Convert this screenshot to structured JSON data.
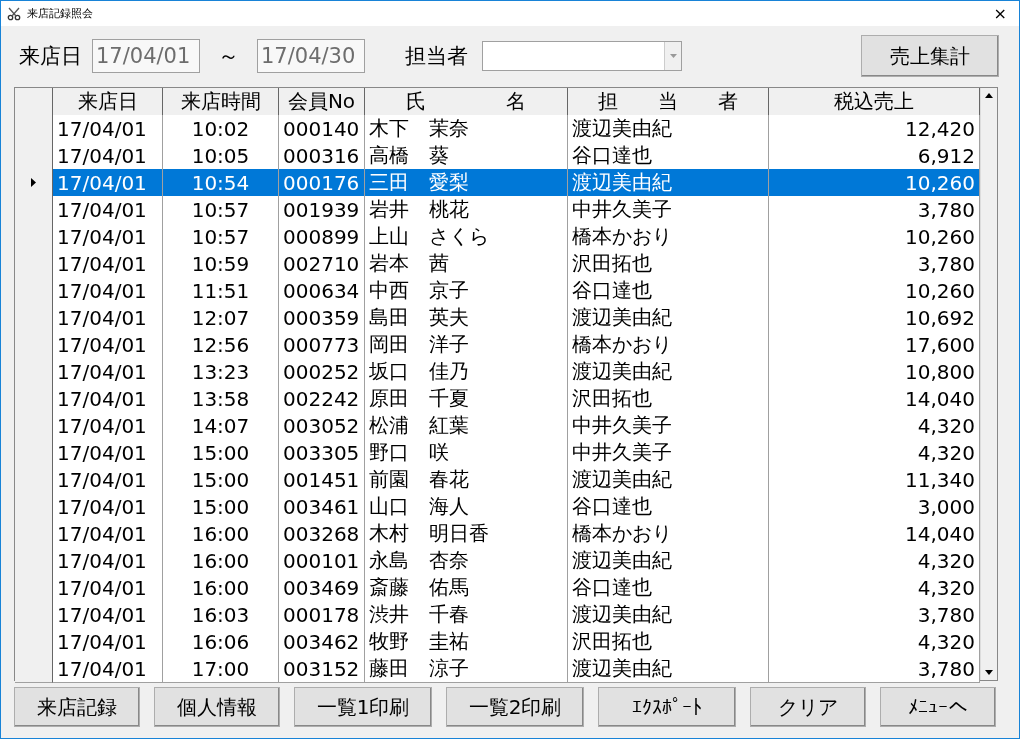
{
  "window": {
    "title": "来店記録照会",
    "close": "×"
  },
  "filter": {
    "date_label": "来店日",
    "date_from": "17/04/01",
    "separator": "～",
    "date_to": "17/04/30",
    "staff_label": "担当者",
    "summary_button": "売上集計"
  },
  "table": {
    "columns": [
      "来店日",
      "来店時間",
      "会員No",
      "氏　　　　名",
      "担　　当　　者",
      "税込売上"
    ],
    "rows": [
      {
        "cells": [
          "17/04/01",
          "10:02",
          "000140",
          "木下　茉奈",
          "渡辺美由紀",
          "12,420"
        ],
        "selected": false
      },
      {
        "cells": [
          "17/04/01",
          "10:05",
          "000316",
          "高橋　葵",
          "谷口達也",
          "6,912"
        ],
        "selected": false
      },
      {
        "cells": [
          "17/04/01",
          "10:54",
          "000176",
          "三田　愛梨",
          "渡辺美由紀",
          "10,260"
        ],
        "selected": true
      },
      {
        "cells": [
          "17/04/01",
          "10:57",
          "001939",
          "岩井　桃花",
          "中井久美子",
          "3,780"
        ],
        "selected": false
      },
      {
        "cells": [
          "17/04/01",
          "10:57",
          "000899",
          "上山　さくら",
          "橋本かおり",
          "10,260"
        ],
        "selected": false
      },
      {
        "cells": [
          "17/04/01",
          "10:59",
          "002710",
          "岩本　茜",
          "沢田拓也",
          "3,780"
        ],
        "selected": false
      },
      {
        "cells": [
          "17/04/01",
          "11:51",
          "000634",
          "中西　京子",
          "谷口達也",
          "10,260"
        ],
        "selected": false
      },
      {
        "cells": [
          "17/04/01",
          "12:07",
          "000359",
          "島田　英夫",
          "渡辺美由紀",
          "10,692"
        ],
        "selected": false
      },
      {
        "cells": [
          "17/04/01",
          "12:56",
          "000773",
          "岡田　洋子",
          "橋本かおり",
          "17,600"
        ],
        "selected": false
      },
      {
        "cells": [
          "17/04/01",
          "13:23",
          "000252",
          "坂口　佳乃",
          "渡辺美由紀",
          "10,800"
        ],
        "selected": false
      },
      {
        "cells": [
          "17/04/01",
          "13:58",
          "002242",
          "原田　千夏",
          "沢田拓也",
          "14,040"
        ],
        "selected": false
      },
      {
        "cells": [
          "17/04/01",
          "14:07",
          "003052",
          "松浦　紅葉",
          "中井久美子",
          "4,320"
        ],
        "selected": false
      },
      {
        "cells": [
          "17/04/01",
          "15:00",
          "003305",
          "野口　咲",
          "中井久美子",
          "4,320"
        ],
        "selected": false
      },
      {
        "cells": [
          "17/04/01",
          "15:00",
          "001451",
          "前園　春花",
          "渡辺美由紀",
          "11,340"
        ],
        "selected": false
      },
      {
        "cells": [
          "17/04/01",
          "15:00",
          "003461",
          "山口　海人",
          "谷口達也",
          "3,000"
        ],
        "selected": false
      },
      {
        "cells": [
          "17/04/01",
          "16:00",
          "003268",
          "木村　明日香",
          "橋本かおり",
          "14,040"
        ],
        "selected": false
      },
      {
        "cells": [
          "17/04/01",
          "16:00",
          "000101",
          "永島　杏奈",
          "渡辺美由紀",
          "4,320"
        ],
        "selected": false
      },
      {
        "cells": [
          "17/04/01",
          "16:00",
          "003469",
          "斎藤　佑馬",
          "谷口達也",
          "4,320"
        ],
        "selected": false
      },
      {
        "cells": [
          "17/04/01",
          "16:03",
          "000178",
          "渋井　千春",
          "渡辺美由紀",
          "3,780"
        ],
        "selected": false
      },
      {
        "cells": [
          "17/04/01",
          "16:06",
          "003462",
          "牧野　圭祐",
          "沢田拓也",
          "4,320"
        ],
        "selected": false
      },
      {
        "cells": [
          "17/04/01",
          "17:00",
          "003152",
          "藤田　涼子",
          "渡辺美由紀",
          "3,780"
        ],
        "selected": false
      }
    ]
  },
  "buttons": [
    "来店記録",
    "個人情報",
    "一覧1印刷",
    "一覧2印刷",
    "ｴｸｽﾎﾟｰﾄ",
    "クリア",
    "ﾒﾆｭｰへ"
  ]
}
